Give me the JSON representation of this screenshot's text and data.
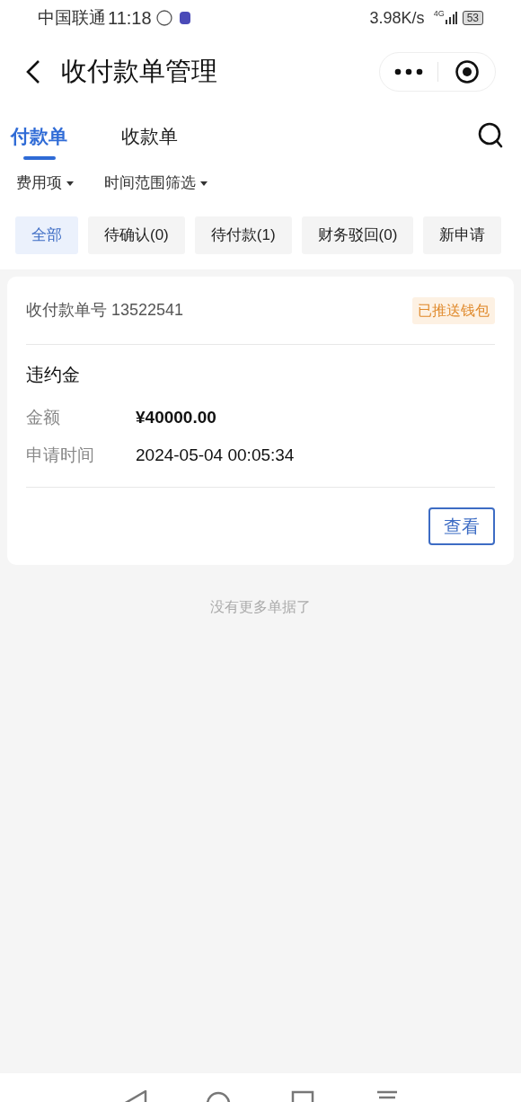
{
  "status_bar": {
    "carrier": "中国联通",
    "time": "11:18",
    "speed": "3.98K/s",
    "network": "4G",
    "battery": "53"
  },
  "header": {
    "title": "收付款单管理"
  },
  "tabs": [
    {
      "label": "付款单",
      "selected": true
    },
    {
      "label": "收款单",
      "selected": false
    }
  ],
  "filters": [
    "费用项",
    "时间范围筛选"
  ],
  "chips": [
    {
      "label": "全部",
      "selected": true
    },
    {
      "label": "待确认(0)",
      "selected": false
    },
    {
      "label": "待付款(1)",
      "selected": false
    },
    {
      "label": "财务驳回(0)",
      "selected": false
    },
    {
      "label": "新申请",
      "selected": false
    }
  ],
  "orders": [
    {
      "number_label": "收付款单号",
      "number": "13522541",
      "status": "已推送钱包",
      "type": "违约金",
      "fields": [
        {
          "label": "金额",
          "value": "¥40000.00",
          "kind": "amount"
        },
        {
          "label": "申请时间",
          "value": "2024-05-04 00:05:34",
          "kind": "text"
        }
      ],
      "button": "查看"
    }
  ],
  "footer": "没有更多单据了"
}
